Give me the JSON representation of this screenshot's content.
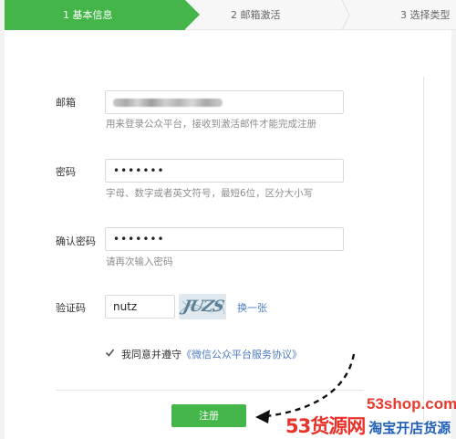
{
  "steps": [
    {
      "label": "1 基本信息",
      "active": true
    },
    {
      "label": "2 邮箱激活",
      "active": false
    },
    {
      "label": "3 选择类型",
      "active": false
    }
  ],
  "form": {
    "email": {
      "label": "邮箱",
      "value_obscured": true,
      "hint": "用来登录公众平台，接收到激活邮件才能完成注册"
    },
    "password": {
      "label": "密码",
      "value": "•••••••",
      "hint": "字母、数字或者英文符号，最短6位，区分大小写"
    },
    "confirm_password": {
      "label": "确认密码",
      "value": "•••••••",
      "hint": "请再次输入密码"
    },
    "captcha": {
      "label": "验证码",
      "value": "nutz",
      "image_text": "JUZS",
      "change_link": "换一张"
    },
    "agreement": {
      "checked": true,
      "text": "我同意并遵守",
      "link": "《微信公众平台服务协议》"
    },
    "submit_label": "注册"
  },
  "watermark": {
    "site": "53shop.com",
    "brand": "53货源网",
    "tagline": "淘宝开店货源"
  },
  "colors": {
    "accent": "#44b549",
    "link": "#4d7cc2",
    "hint": "#8d8d8d"
  }
}
